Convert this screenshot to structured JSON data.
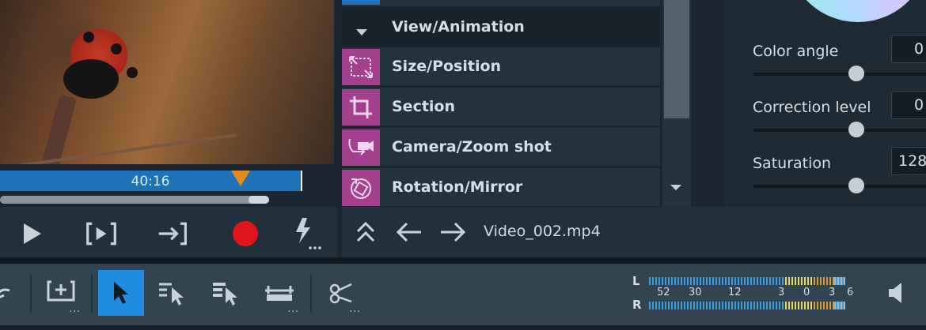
{
  "preview": {
    "timecode": "40:16"
  },
  "effects": {
    "items": [
      {
        "label": "View/Animation",
        "icon": "chevron-down-icon"
      },
      {
        "label": "Size/Position",
        "icon": "size-position-icon"
      },
      {
        "label": "Section",
        "icon": "crop-icon"
      },
      {
        "label": "Camera/Zoom shot",
        "icon": "camera-zoom-icon"
      },
      {
        "label": "Rotation/Mirror",
        "icon": "rotation-icon"
      }
    ]
  },
  "footer": {
    "filename": "Video_002.mp4"
  },
  "color": {
    "fields": [
      {
        "label": "Color angle",
        "value": "0"
      },
      {
        "label": "Correction level",
        "value": "0"
      },
      {
        "label": "Saturation",
        "value": "128"
      }
    ]
  },
  "meter": {
    "left_label": "L",
    "right_label": "R",
    "scale": [
      "52",
      "30",
      "12",
      "3",
      "0",
      "3",
      "6"
    ]
  },
  "colors": {
    "accent": "#1e8ce0",
    "effect_icon_bg": "#a2408e",
    "timeline": "#1e73b8",
    "marker": "#e48a1e",
    "record": "#e0141b"
  }
}
